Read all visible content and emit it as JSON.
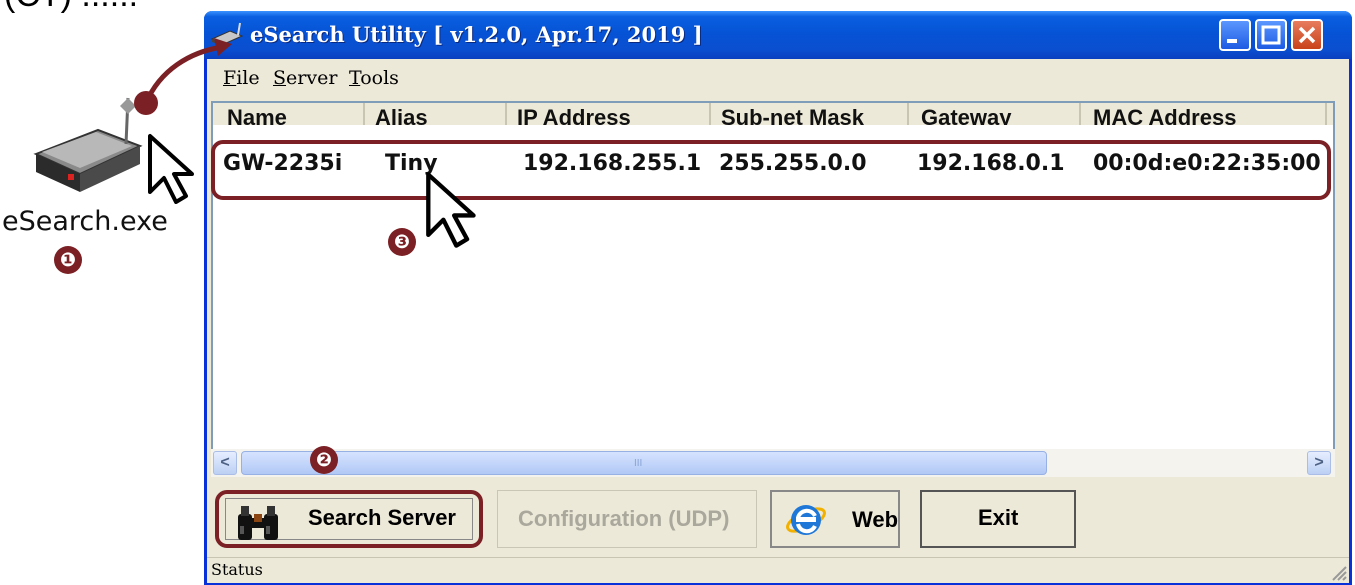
{
  "annotation": {
    "top_fragment": "(CT) ...... -",
    "exe_label": "eSearch.exe",
    "steps": [
      "❶",
      "❷",
      "❸"
    ],
    "highlight_color": "#7b2024"
  },
  "window": {
    "title": "eSearch Utility [ v1.2.0, Apr.17, 2019 ]",
    "title_icon": "network-device-icon",
    "title_buttons": [
      "minimize",
      "maximize",
      "close"
    ],
    "menu": [
      {
        "accel": "F",
        "rest": "ile"
      },
      {
        "accel": "S",
        "rest": "erver"
      },
      {
        "accel": "T",
        "rest": "ools"
      }
    ]
  },
  "table": {
    "columns": [
      "Name",
      "Alias",
      "IP Address",
      "Sub-net Mask",
      "Gateway",
      "MAC Address"
    ],
    "rows": [
      {
        "name": "GW-2235i",
        "alias": "Tiny",
        "ip": "192.168.255.1",
        "mask": "255.255.0.0",
        "gateway": "192.168.0.1",
        "mac": "00:0d:e0:22:35:00"
      }
    ]
  },
  "scrollbar": {
    "left": "<",
    "right": ">",
    "grip": "III"
  },
  "buttons": {
    "search": "Search Server",
    "config": "Configuration (UDP)",
    "web": "Web",
    "exit": "Exit"
  },
  "status": {
    "label": "Status"
  },
  "colors": {
    "titlebar": "#0a5fe0",
    "window_bg": "#ece9d8",
    "accent": "#7b2024"
  }
}
